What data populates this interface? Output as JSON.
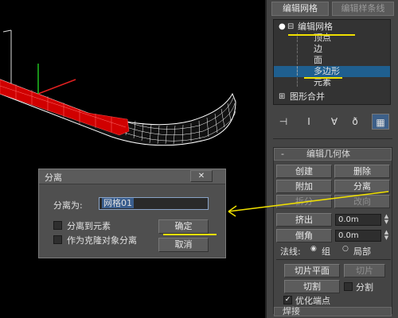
{
  "panel": {
    "tabs": [
      "编辑网格",
      "编辑样条线"
    ],
    "stack": {
      "items": [
        {
          "label": "编辑网格",
          "prefix": "⊟",
          "light": true
        },
        {
          "label": "顶点"
        },
        {
          "label": "边"
        },
        {
          "label": "面"
        },
        {
          "label": "多边形",
          "selected": true
        },
        {
          "label": "元素"
        },
        {
          "label": "图形合并",
          "prefix": "⊞"
        }
      ]
    },
    "rollout": {
      "title": "编辑几何体",
      "collapse_symbol": "-",
      "buttons": {
        "create": "创建",
        "delete": "删除",
        "attach": "附加",
        "detach": "分离",
        "split": "拆分",
        "turn": "改向",
        "extrude": "挤出",
        "chamfer": "倒角",
        "slice_plane": "切片平面",
        "slice": "切片",
        "cut": "切割"
      },
      "extrude_value": "0.0m",
      "chamfer_value": "0.0m",
      "normal_label": "法线:",
      "normal_options": [
        "组",
        "局部"
      ],
      "split_label": "分割",
      "refine_label": "优化端点",
      "next_rollout": "焊接"
    }
  },
  "dialog": {
    "title": "分离",
    "close_symbol": "✕",
    "name_label": "分离为:",
    "name_value": "网格01",
    "option_element": "分离到元素",
    "option_clone": "作为克隆对象分离",
    "ok": "确定",
    "cancel": "取消"
  },
  "colors": {
    "annotation": "#f0e000",
    "selection": "#1f5f8f",
    "mesh_selected": "#e00000",
    "mesh_wire": "#ffffff"
  }
}
